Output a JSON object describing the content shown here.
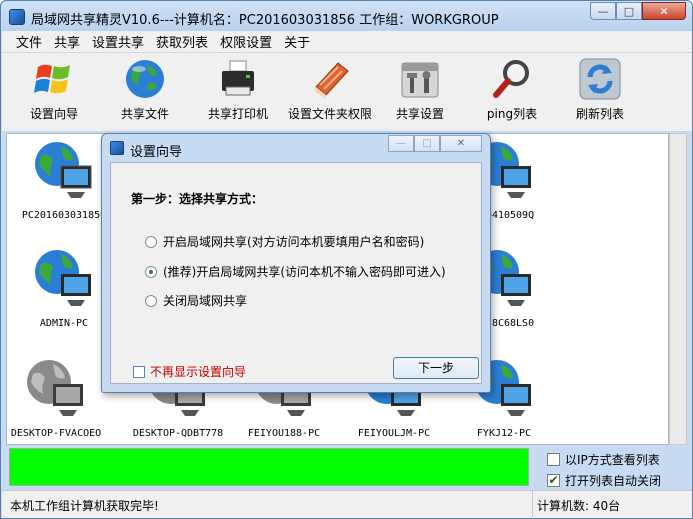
{
  "window": {
    "title": "局域网共享精灵V10.6---计算机名：PC201603031856  工作组：WORKGROUP",
    "min": "—",
    "max": "□",
    "close": "✕"
  },
  "menu": [
    "文件",
    "共享",
    "设置共享",
    "获取列表",
    "权限设置",
    "关于"
  ],
  "toolbar": [
    {
      "label": "设置向导",
      "icon": "windows-logo-icon"
    },
    {
      "label": "共享文件",
      "icon": "globe-icon"
    },
    {
      "label": "共享打印机",
      "icon": "printer-icon"
    },
    {
      "label": "设置文件夹权限",
      "icon": "folder-book-icon"
    },
    {
      "label": "共享设置",
      "icon": "tools-icon"
    },
    {
      "label": "ping列表",
      "icon": "magnifier-icon"
    },
    {
      "label": "刷新列表",
      "icon": "refresh-icon"
    }
  ],
  "computers": {
    "row1": [
      "PC201603031856",
      "",
      "",
      "",
      "-20410509Q"
    ],
    "row2": [
      "ADMIN-PC",
      "",
      "",
      "",
      "OP-8C68LS0"
    ],
    "row3": [
      "DESKTOP-FVACOEO",
      "DESKTOP-QDBT778",
      "FEIYOU188-PC",
      "FEIYOULJM-PC",
      "FYKJ12-PC"
    ]
  },
  "progress": {
    "value": 1.0,
    "color": "#00ff00"
  },
  "options": {
    "ip_view": "以IP方式查看列表",
    "auto_close": "打开列表自动关闭",
    "auto_close_checked": "✔"
  },
  "status": {
    "left": "本机工作组计算机获取完毕!",
    "right": "计算机数: 40台"
  },
  "dialog": {
    "title": "设置向导",
    "min": "—",
    "max": "□",
    "close": "✕",
    "step": "第一步：选择共享方式：",
    "options": [
      "开启局域网共享(对方访问本机要填用户名和密码)",
      "(推荐)开启局域网共享(访问本机不输入密码即可进入)",
      "关闭局域网共享"
    ],
    "selected_index": 1,
    "dont_show": "不再显示设置向导",
    "next": "下一步"
  }
}
